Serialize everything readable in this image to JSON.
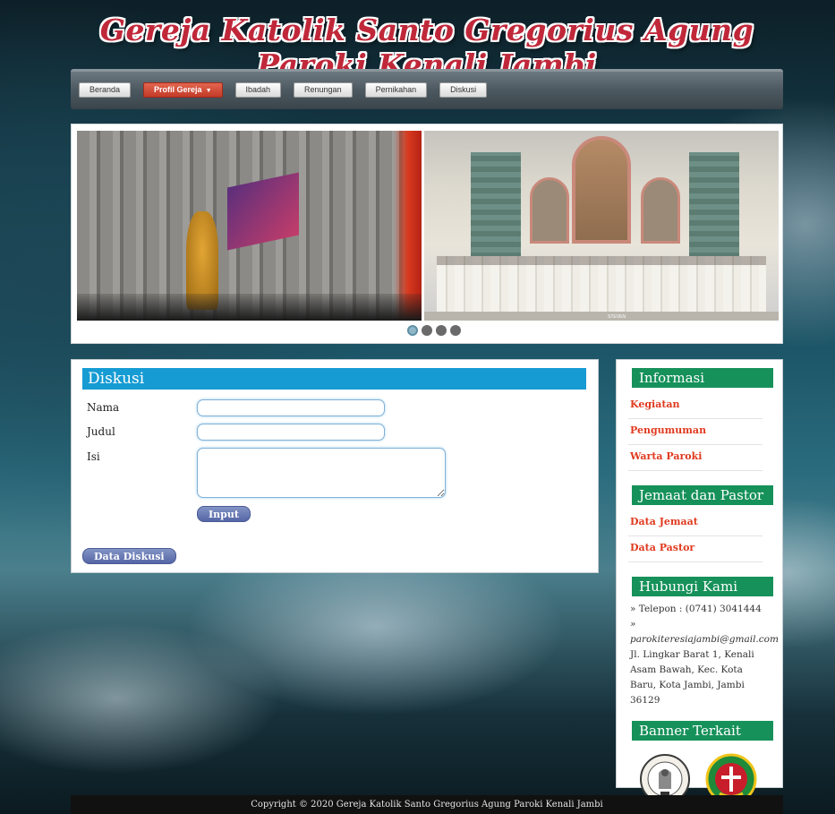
{
  "site": {
    "title": "Gereja Katolik Santo Gregorius Agung Paroki Kenali Jambi"
  },
  "nav": {
    "items": [
      {
        "label": "Beranda"
      },
      {
        "label": "Profil Gereja",
        "caret": "▼"
      },
      {
        "label": "Ibadah"
      },
      {
        "label": "Renungan"
      },
      {
        "label": "Pernikahan"
      },
      {
        "label": "Diskusi"
      }
    ]
  },
  "slider": {
    "slide_count": 4,
    "active_index": 0,
    "caption_small": "STEVEN"
  },
  "main": {
    "title": "Diskusi",
    "form": {
      "nama_label": "Nama",
      "judul_label": "Judul",
      "isi_label": "Isi",
      "nama_value": "",
      "judul_value": "",
      "isi_value": "",
      "submit_label": "Input"
    },
    "data_button": "Data Diskusi"
  },
  "sidebar": {
    "informasi": {
      "title": "Informasi",
      "links": [
        "Kegiatan",
        "Pengumuman",
        "Warta Paroki"
      ]
    },
    "jemaat": {
      "title": "Jemaat dan Pastor",
      "links": [
        "Data Jemaat",
        "Data Pastor"
      ]
    },
    "hubungi": {
      "title": "Hubungi Kami",
      "telepon": "» Telepon : (0741) 3041444",
      "email": "» parokiteresiajambi@gmail.com",
      "address": "Jl. Lingkar Barat 1, Kenali Asam Bawah, Kec. Kota Baru, Kota Jambi, Jambi 36129"
    },
    "banner": {
      "title": "Banner Terkait"
    }
  },
  "footer": {
    "text": "Copyright © 2020 Gereja Katolik Santo Gregorius Agung Paroki Kenali Jambi"
  },
  "colors": {
    "nav_active": "#c33b28",
    "main_title_bg": "#169bd3",
    "side_head_bg": "#16915a",
    "side_link": "#e03a1f",
    "button_bg": "#5566a6"
  }
}
